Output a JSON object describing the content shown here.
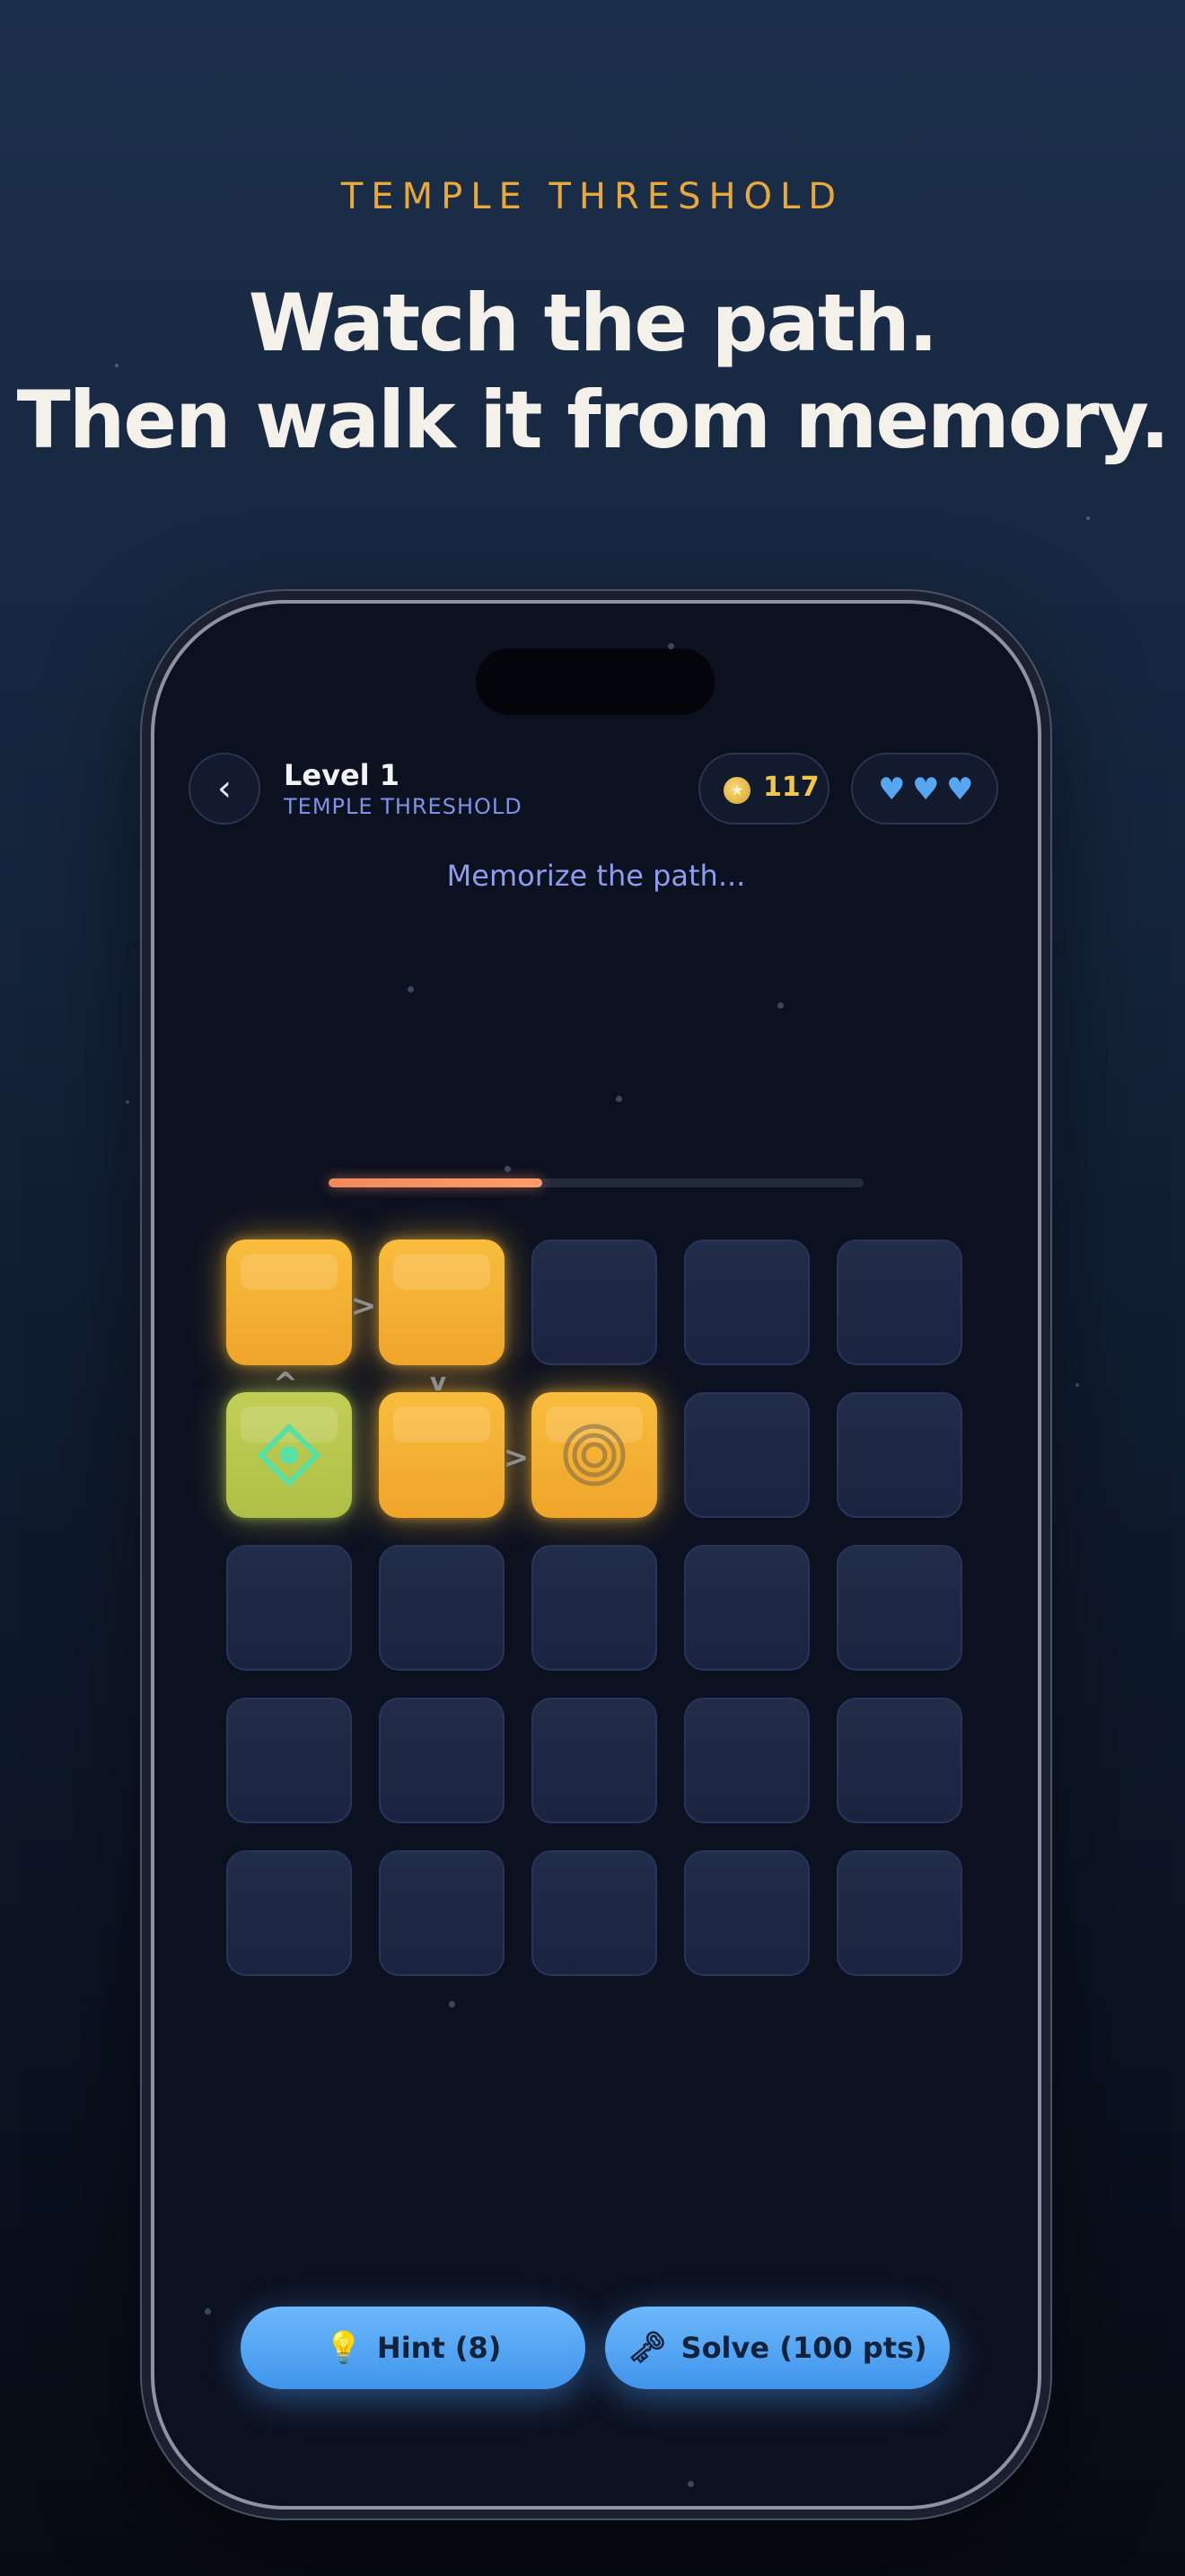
{
  "promo": {
    "kicker": "TEMPLE THRESHOLD",
    "headline_line1": "Watch the path.",
    "headline_line2": "Then walk it from memory."
  },
  "header": {
    "back_icon": "chevron-left-icon",
    "back_glyph": "‹",
    "level_title": "Level 1",
    "level_subtitle": "TEMPLE THRESHOLD",
    "coins": "117",
    "coin_icon": "coin-icon",
    "hearts": [
      "♥",
      "♥",
      "♥"
    ],
    "heart_icon": "heart-icon"
  },
  "status_text": "Memorize the path...",
  "progress": {
    "fraction": 0.4,
    "color": "#f08a5d"
  },
  "grid": {
    "rows": 5,
    "cols": 5,
    "lit_tiles": [
      "0-0",
      "0-1",
      "1-0",
      "1-1",
      "1-2"
    ],
    "start_tile": "1-0",
    "end_tile": "1-2",
    "start_icon": "diamond-target-icon",
    "end_icon": "concentric-rings-icon",
    "arrow_glyphs": [
      ">",
      "v",
      "^",
      ">"
    ]
  },
  "actions": {
    "hint_label": "Hint (8)",
    "hint_icon": "lightbulb-icon",
    "hint_glyph": "💡",
    "solve_label": "Solve (100 pts)",
    "solve_icon": "key-icon",
    "solve_glyph": "🗝"
  },
  "colors": {
    "accent_gold": "#e8a93c",
    "tile_lit": "#f9bd3e",
    "tile_start": "#c2cf57",
    "button_blue": "#4fa3f2",
    "heart_blue": "#56a6f2"
  }
}
